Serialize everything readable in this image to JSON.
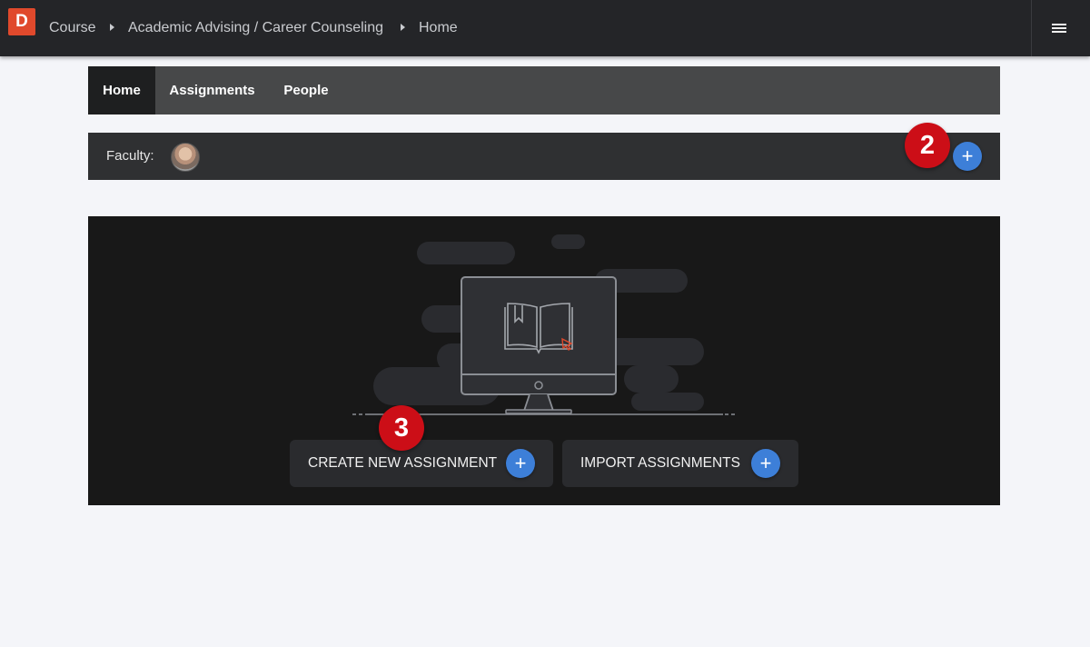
{
  "header": {
    "logo_letter": "D",
    "breadcrumb": [
      "Course",
      "Academic Advising / Career Counseling",
      "Home"
    ]
  },
  "tabs": [
    {
      "label": "Home",
      "active": true
    },
    {
      "label": "Assignments",
      "active": false
    },
    {
      "label": "People",
      "active": false
    }
  ],
  "faculty": {
    "label": "Faculty:",
    "add_button": "+"
  },
  "annotations": {
    "step2": "2",
    "step3": "3"
  },
  "empty_state": {
    "create_label": "CREATE NEW ASSIGNMENT",
    "import_label": "IMPORT ASSIGNMENTS",
    "plus": "+"
  },
  "colors": {
    "brand": "#e0492c",
    "accent": "#3d7fd8",
    "badge": "#cc0e17"
  }
}
